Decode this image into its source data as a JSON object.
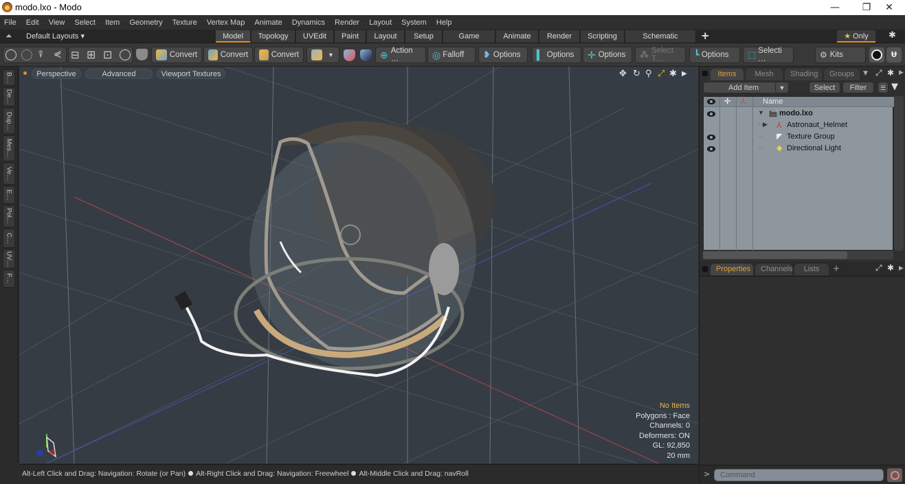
{
  "window": {
    "title": "modo.lxo - Modo",
    "controls": {
      "minimize": "—",
      "restore": "❐",
      "close": "✕"
    }
  },
  "menubar": [
    "File",
    "Edit",
    "View",
    "Select",
    "Item",
    "Geometry",
    "Texture",
    "Vertex Map",
    "Animate",
    "Dynamics",
    "Render",
    "Layout",
    "System",
    "Help"
  ],
  "layoutbar": {
    "layouts_label": "Default Layouts ▾",
    "tabs": [
      "Model",
      "Topology",
      "UVEdit",
      "Paint",
      "Layout",
      "Setup",
      "Game Tools",
      "Animate",
      "Render",
      "Scripting",
      "Schematic Fusion"
    ],
    "active_tab": "Model",
    "add_tab": "+",
    "only_label": "Only",
    "only_star": "★",
    "accent_color": "#e0902a"
  },
  "toolbar": {
    "convert_1": "Convert",
    "convert_2": "Convert",
    "convert_3": "Convert",
    "action": "Action …",
    "falloff": "Falloff",
    "options_1": "Options",
    "options_2": "Options",
    "options_3": "Options",
    "select_t": "Select T…",
    "options_4": "Options",
    "selection": "Selecti …",
    "kits": "Kits"
  },
  "left_tabs": [
    "B…",
    "De…",
    "Dup…",
    "Mes…",
    "Ve…",
    "E…",
    "Pol…",
    "C…",
    "UV…",
    "F…"
  ],
  "viewport": {
    "mode_dot_color": "#e0902a",
    "perspective": "Perspective",
    "advanced": "Advanced",
    "textures": "Viewport Textures",
    "icons": [
      "move-icon",
      "rotate-icon",
      "zoom-icon",
      "maximize-icon",
      "gear-icon",
      "more-icon"
    ],
    "stats": {
      "selection": "No Items",
      "polygons": "Polygons : Face",
      "channels": "Channels: 0",
      "deformers": "Deformers: ON",
      "gl": "GL: 92,850",
      "unit": "20 mm"
    }
  },
  "statusbar": {
    "hint1": "Alt-Left Click and Drag: Navigation: Rotate (or Pan)",
    "hint2": "Alt-Right Click and Drag: Navigation: Freewheel",
    "hint3": "Alt-Middle Click and Drag: navRoll"
  },
  "items_panel": {
    "tabs": [
      "Items",
      "Mesh …",
      "Shading",
      "Groups"
    ],
    "active_tab": "Items",
    "add_item": "Add Item",
    "select": "Select",
    "filter": "Filter",
    "col_name": "Name",
    "tree": [
      {
        "label": "modo.lxo",
        "level": 0,
        "expanded": true,
        "bold": true,
        "visible": true,
        "icon": "scene-icon"
      },
      {
        "label": "Astronaut_Helmet",
        "level": 1,
        "expanded": false,
        "bold": false,
        "visible": false,
        "icon": "locator-icon"
      },
      {
        "label": "Texture Group",
        "level": 1,
        "expanded": false,
        "bold": false,
        "visible": true,
        "icon": "texture-group-icon"
      },
      {
        "label": "Directional Light",
        "level": 1,
        "expanded": false,
        "bold": false,
        "visible": true,
        "icon": "light-icon"
      }
    ]
  },
  "properties_panel": {
    "tabs": [
      "Properties",
      "Channels",
      "Lists"
    ],
    "active_tab": "Properties",
    "add": "+"
  },
  "command": {
    "prompt": ">",
    "placeholder": "Command"
  }
}
